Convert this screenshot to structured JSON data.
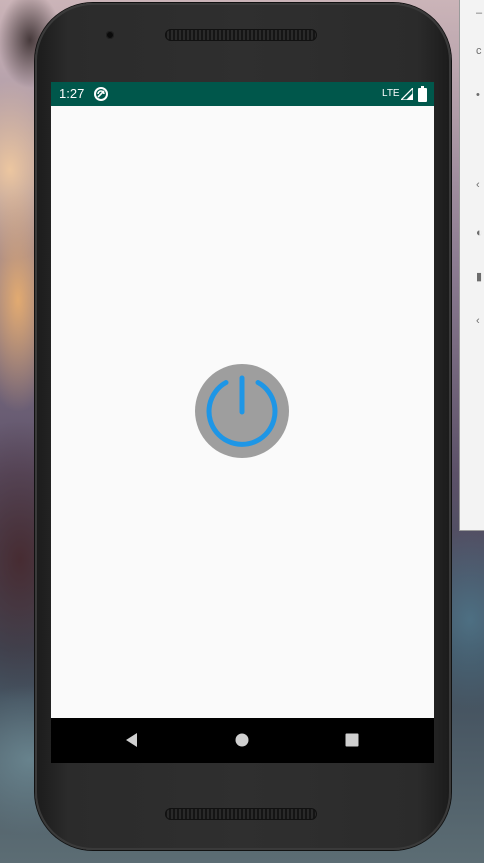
{
  "status_bar": {
    "time": "1:27",
    "network": "LTE",
    "background_color": "#00574b",
    "icons": [
      "sync-icon",
      "cell-signal-icon",
      "battery-icon"
    ]
  },
  "app": {
    "background_color": "#fafafa",
    "power_button": {
      "icon": "power-icon",
      "fill_color": "#9e9e9e",
      "icon_color": "#1e96e6"
    }
  },
  "navigation_bar": {
    "background_color": "#000000",
    "buttons": [
      "back-icon",
      "home-icon",
      "recents-icon"
    ]
  }
}
